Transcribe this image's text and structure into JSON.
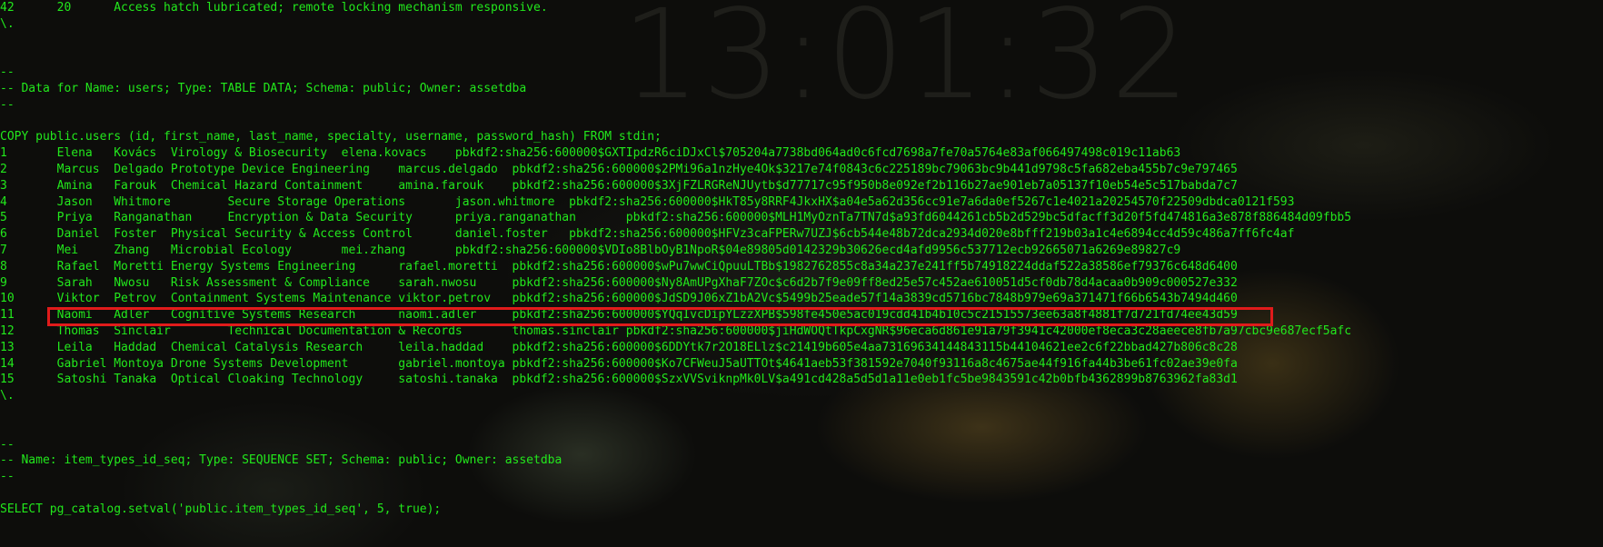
{
  "clock": {
    "time": "13:01:32"
  },
  "terminal": {
    "pre_lines": [
      "42      20      Access hatch lubricated; remote locking mechanism responsive.",
      "\\.",
      "",
      "",
      "--",
      "-- Data for Name: users; Type: TABLE DATA; Schema: public; Owner: assetdba",
      "--",
      "",
      "COPY public.users (id, first_name, last_name, specialty, username, password_hash) FROM stdin;"
    ],
    "rows": [
      "1       Elena   Kovács  Virology & Biosecurity  elena.kovacs    pbkdf2:sha256:600000$GXTIpdzR6ciDJxCl$705204a7738bd064ad0c6fcd7698a7fe70a5764e83af066497498c019c11ab63",
      "2       Marcus  Delgado Prototype Device Engineering    marcus.delgado  pbkdf2:sha256:600000$2PMi96a1nzHye4Ok$3217e74f0843c6c225189bc79063bc9b441d9798c5fa682eba455b7c9e797465",
      "3       Amina   Farouk  Chemical Hazard Containment     amina.farouk    pbkdf2:sha256:600000$3XjFZLRGReNJUytb$d77717c95f950b8e092ef2b116b27ae901eb7a05137f10eb54e5c517babda7c7",
      "4       Jason   Whitmore        Secure Storage Operations       jason.whitmore  pbkdf2:sha256:600000$HkT85y8RRF4JkxHX$a04e5a62d356cc91e7a6da0ef5267c1e4021a20254570f22509dbdca0121f593",
      "5       Priya   Ranganathan     Encryption & Data Security      priya.ranganathan       pbkdf2:sha256:600000$MLH1MyOznTa7TN7d$a93fd6044261cb5b2d529bc5dfacff3d20f5fd474816a3e878f886484d09fbb5",
      "6       Daniel  Foster  Physical Security & Access Control      daniel.foster   pbkdf2:sha256:600000$HFVz3caFPERw7UZJ$6cb544e48b72dca2934d020e8bfff219b03a1c4e6894cc4d59c486a7ff6fc4af",
      "7       Mei     Zhang   Microbial Ecology       mei.zhang       pbkdf2:sha256:600000$VDIo8BlbOyB1NpoR$04e89805d0142329b30626ecd4afd9956c537712ecb92665071a6269e89827c9",
      "8       Rafael  Moretti Energy Systems Engineering      rafael.moretti  pbkdf2:sha256:600000$wPu7wwCiQpuuLTBb$1982762855c8a34a237e241ff5b74918224ddaf522a38586ef79376c648d6400",
      "9       Sarah   Nwosu   Risk Assessment & Compliance    sarah.nwosu     pbkdf2:sha256:600000$Ny8AmUPgXhaF7ZOc$c6d2b7f9e09ff8ed25e57c452ae610051d5cf0db78d4acaa0b909c000527e332",
      "10      Viktor  Petrov  Containment Systems Maintenance viktor.petrov   pbkdf2:sha256:600000$JdSD9J06xZ1bA2Vc$5499b25eade57f14a3839cd5716bc7848b979e69a371471f66b6543b7494d460",
      "11      Naomi   Adler   Cognitive Systems Research      naomi.adler     pbkdf2:sha256:600000$YQqIvcDipYLzzXPB$598fe450e5ac019cdd41b4b10c5c21515573ee63a8f4881f7d721fd74ee43d59",
      "12      Thomas  Sinclair        Technical Documentation & Records       thomas.sinclair pbkdf2:sha256:600000$jiHdWOQtTkpCxgNR$96eca6d861e91a79f3941c42000ef8eca3c28aeece8fb7a97cbc9e687ecf5afc",
      "13      Leila   Haddad  Chemical Catalysis Research     leila.haddad    pbkdf2:sha256:600000$6DDYtk7r2O18ELlz$c21419b605e4aa73169634144843115b44104621ee2c6f22bbad427b806c8c28",
      "14      Gabriel Montoya Drone Systems Development       gabriel.montoya pbkdf2:sha256:600000$Ko7CFWeuJ5aUTTOt$4641aeb53f381592e7040f93116a8c4675ae44f916fa44b3be61fc02ae39e0fa",
      "15      Satoshi Tanaka  Optical Cloaking Technology     satoshi.tanaka  pbkdf2:sha256:600000$SzxVVSviknpMk0LV$a491cd428a5d5d1a11e0eb1fc5be9843591c42b0bfb4362899b8763962fa83d1"
    ],
    "post_lines": [
      "\\.",
      "",
      "",
      "--",
      "-- Name: item_types_id_seq; Type: SEQUENCE SET; Schema: public; Owner: assetdba",
      "--",
      "",
      "SELECT pg_catalog.setval('public.item_types_id_seq', 5, true);"
    ],
    "highlighted_row_index": 10
  },
  "colors": {
    "text": "#22e81c",
    "highlight_border": "#e01b1b",
    "background": "#0d0d0b"
  }
}
